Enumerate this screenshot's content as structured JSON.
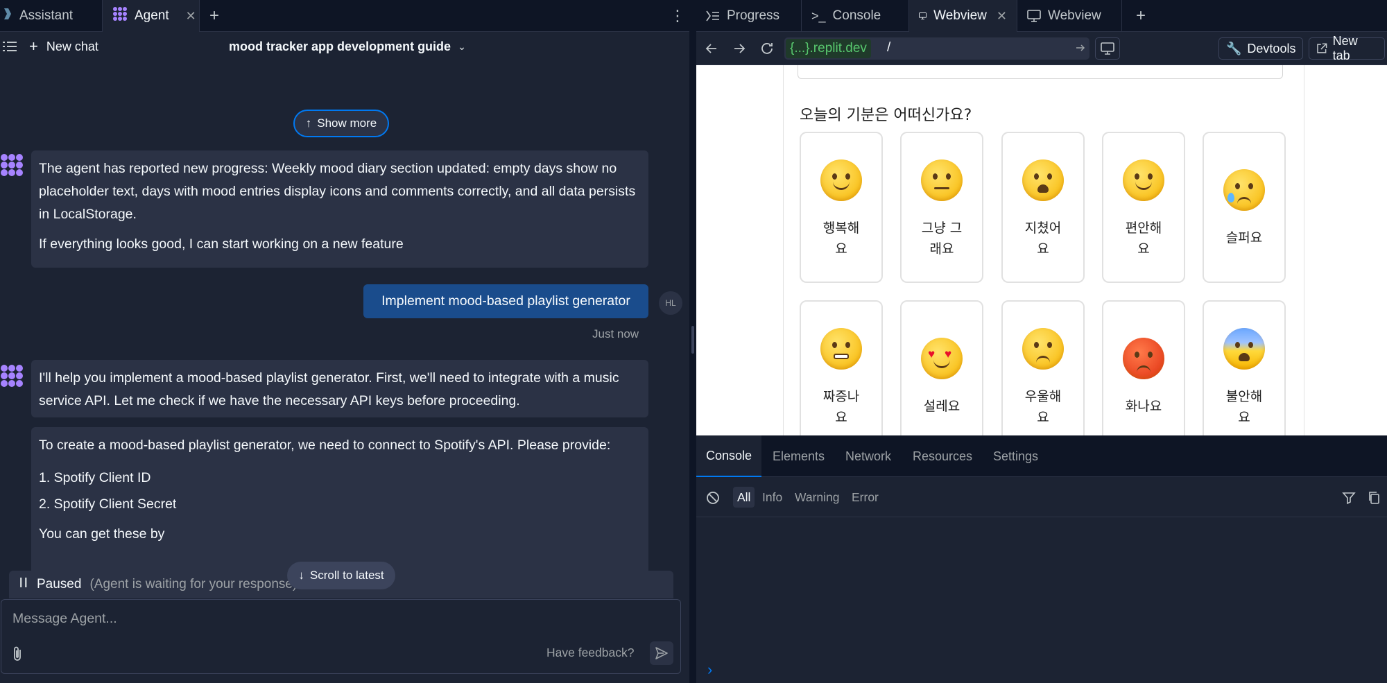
{
  "left_tabs": [
    {
      "label": "Assistant"
    },
    {
      "label": "Agent",
      "active": true
    }
  ],
  "left_header": {
    "new_chat": "New chat",
    "chat_title": "mood tracker app development guide"
  },
  "chat": {
    "show_more": "Show more",
    "messages": [
      {
        "role": "agent",
        "paragraphs": [
          "The agent has reported new progress: Weekly mood diary section updated: empty days show no placeholder text, days with mood entries display icons and comments correctly, and all data persists in LocalStorage.",
          "If everything looks good, I can start working on a new feature"
        ]
      },
      {
        "role": "user",
        "text": "Implement mood-based playlist generator",
        "initials": "HL",
        "time": "Just now"
      },
      {
        "role": "agent",
        "paragraphs": [
          "I'll help you implement a mood-based playlist generator. First, we'll need to integrate with a music service API. Let me check if we have the necessary API keys before proceeding."
        ]
      },
      {
        "role": "agent",
        "paragraphs": [
          "To create a mood-based playlist generator, we need to connect to Spotify's API. Please provide:",
          "1. Spotify Client ID",
          "2. Spotify Client Secret",
          "You can get these by"
        ]
      }
    ],
    "scroll_latest": "Scroll to latest",
    "paused_label": "Paused",
    "paused_sub": "(Agent is waiting for your response)",
    "input_placeholder": "Message Agent...",
    "feedback": "Have feedback?"
  },
  "right_tabs": [
    {
      "label": "Progress",
      "icon": "progress-icon"
    },
    {
      "label": "Console",
      "icon": "terminal-icon"
    },
    {
      "label": "Webview",
      "icon": "monitor-icon",
      "active": true
    },
    {
      "label": "Webview",
      "icon": "monitor-icon"
    }
  ],
  "address_bar": {
    "host": "{...}.replit.dev",
    "path": "/",
    "devtools": "Devtools",
    "new_tab": "New tab"
  },
  "webview": {
    "question": "오늘의 기분은 어떠신가요?",
    "moods": [
      {
        "label": "행복해\n요",
        "emoji": "happy"
      },
      {
        "label": "그냥 그\n래요",
        "emoji": "neutral"
      },
      {
        "label": "지쳤어\n요",
        "emoji": "tired"
      },
      {
        "label": "편안해\n요",
        "emoji": "relieved"
      },
      {
        "label": "슬퍼요",
        "emoji": "sad"
      },
      {
        "label": "짜증나\n요",
        "emoji": "annoyed"
      },
      {
        "label": "설레요",
        "emoji": "excited"
      },
      {
        "label": "우울해\n요",
        "emoji": "depressed"
      },
      {
        "label": "화나요",
        "emoji": "angry"
      },
      {
        "label": "불안해\n요",
        "emoji": "anxious"
      }
    ]
  },
  "devtools": {
    "tabs": [
      "Console",
      "Elements",
      "Network",
      "Resources",
      "Settings"
    ],
    "filters": [
      "All",
      "Info",
      "Warning",
      "Error"
    ]
  },
  "colors": {
    "accent": "#0079f2",
    "user_bubble": "#1a4c8c",
    "agent_purple": "#a683ff"
  }
}
